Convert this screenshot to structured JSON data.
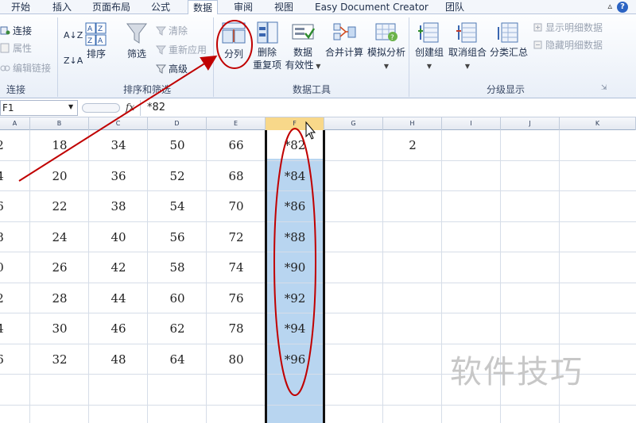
{
  "tabs": [
    "开始",
    "插入",
    "页面布局",
    "公式",
    "数据",
    "审阅",
    "视图",
    "Easy Document Creator",
    "团队"
  ],
  "ribbon": {
    "connections": {
      "items": [
        "连接",
        "属性",
        "编辑链接"
      ],
      "group_label": "连接"
    },
    "sort_filter": {
      "sort_asc": "A↓Z",
      "sort_desc": "Z↓A",
      "sort_label": "排序",
      "filter_label": "筛选",
      "clear": "清除",
      "reapply": "重新应用",
      "advanced": "高级",
      "group_label": "排序和筛选"
    },
    "data_tools": {
      "split_column": "分列",
      "remove_duplicates_line1": "删除",
      "remove_duplicates_line2": "重复项",
      "data_validation_line1": "数据",
      "data_validation_line2": "有效性",
      "consolidate": "合并计算",
      "what_if": "模拟分析",
      "group_label": "数据工具"
    },
    "outline": {
      "group": "创建组",
      "ungroup": "取消组合",
      "subtotal": "分类汇总",
      "show_detail": "显示明细数据",
      "hide_detail": "隐藏明细数据",
      "group_label": "分级显示"
    }
  },
  "formula_bar": {
    "name_box": "F1",
    "fx": "fx",
    "content": "*82"
  },
  "columns": [
    "A",
    "B",
    "C",
    "D",
    "E",
    "F",
    "G",
    "H",
    "I",
    "J",
    "K"
  ],
  "rows": [
    [
      "2",
      "18",
      "34",
      "50",
      "66",
      "*82",
      "",
      "2"
    ],
    [
      "4",
      "20",
      "36",
      "52",
      "68",
      "*84",
      "",
      ""
    ],
    [
      "6",
      "22",
      "38",
      "54",
      "70",
      "*86",
      "",
      ""
    ],
    [
      "8",
      "24",
      "40",
      "56",
      "72",
      "*88",
      "",
      ""
    ],
    [
      "0",
      "26",
      "42",
      "58",
      "74",
      "*90",
      "",
      ""
    ],
    [
      "2",
      "28",
      "44",
      "60",
      "76",
      "*92",
      "",
      ""
    ],
    [
      "4",
      "30",
      "46",
      "62",
      "78",
      "*94",
      "",
      ""
    ],
    [
      "6",
      "32",
      "48",
      "64",
      "80",
      "*96",
      "",
      ""
    ]
  ],
  "watermark": "软件技巧",
  "colors": {
    "selection": "#b8d5f0",
    "selected_header": "#f8d88a",
    "annotation": "#c00000"
  }
}
